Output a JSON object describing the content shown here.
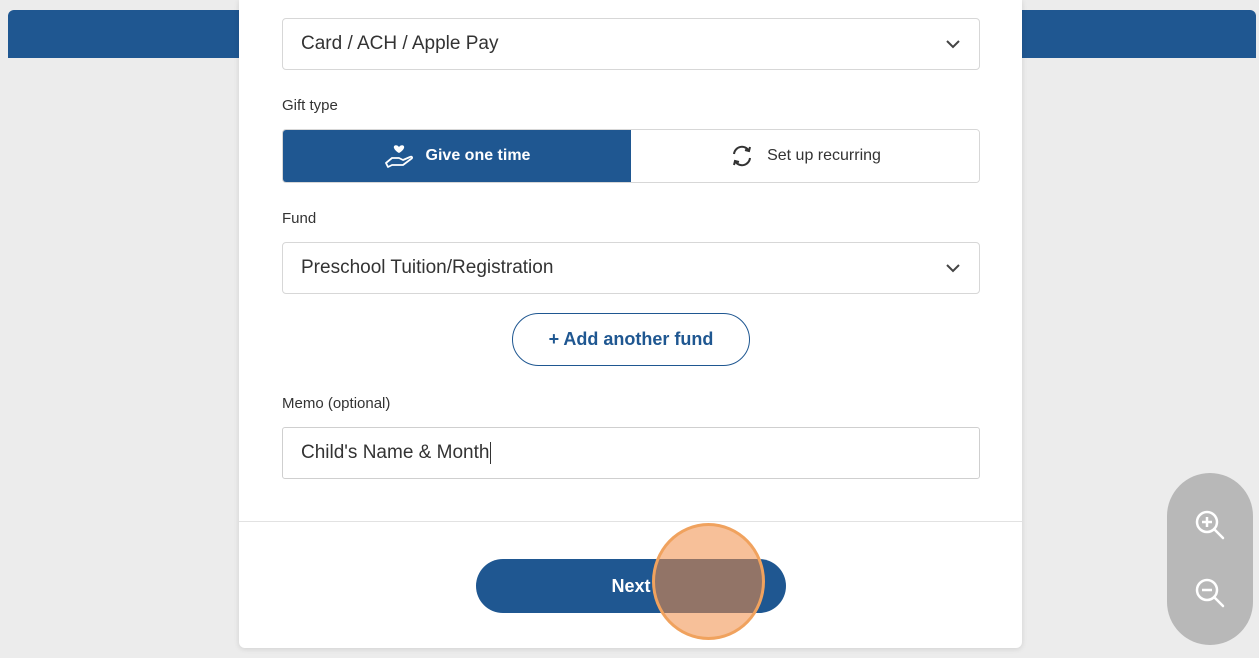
{
  "payment": {
    "method_value": "Card / ACH / Apple Pay"
  },
  "gift_type": {
    "label": "Gift type",
    "options": [
      {
        "label": "Give one time",
        "icon": "hand-heart-icon",
        "selected": true
      },
      {
        "label": "Set up recurring",
        "icon": "recurring-arrows-icon",
        "selected": false
      }
    ]
  },
  "fund": {
    "label": "Fund",
    "value": "Preschool Tuition/Registration",
    "add_button_label": "+ Add another fund"
  },
  "memo": {
    "label": "Memo (optional)",
    "value": "Child's Name & Month"
  },
  "footer": {
    "next_label": "Next"
  },
  "zoom_controls": {
    "zoom_in_icon": "zoom-in-icon",
    "zoom_out_icon": "zoom-out-icon"
  },
  "colors": {
    "brand": "#1f5791",
    "highlight": "#f0a25e",
    "background": "#ececec"
  }
}
